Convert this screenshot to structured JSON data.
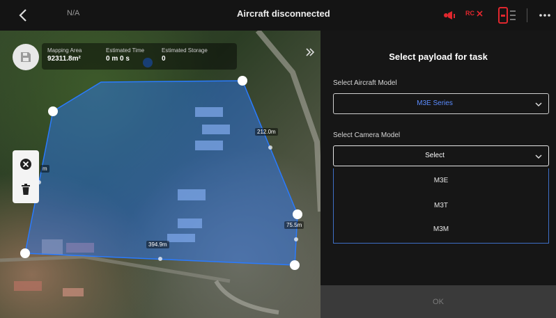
{
  "topbar": {
    "back_icon": "chevron-left-icon",
    "aircraft_label": "N/A",
    "status": "Aircraft disconnected",
    "rtk_icon": "rtk-signal-icon",
    "rc_label": "RC",
    "rc_status_icon": "close-icon",
    "battery_icon": "battery-icon",
    "more_icon": "more-icon",
    "alert_color": "#e0272e"
  },
  "map": {
    "save_icon": "save-icon",
    "info": [
      {
        "label": "Mapping Area",
        "value": "92311.8m²"
      },
      {
        "label": "Estimated Time",
        "value": "0 m 0 s"
      },
      {
        "label": "Estimated Storage",
        "value": "0"
      }
    ],
    "expand_icon": "double-chevron-right-icon",
    "tools": {
      "clear_icon": "close-circle-icon",
      "delete_icon": "trash-icon"
    },
    "distances": [
      "212.0m",
      "75.5m",
      "394.9m",
      "m"
    ],
    "polygon_fill": "#2a7bff"
  },
  "panel": {
    "title": "Select payload for task",
    "aircraft_label": "Select Aircraft Model",
    "aircraft_value": "M3E Series",
    "aircraft_value_color": "#5b8cff",
    "camera_label": "Select Camera Model",
    "camera_value": "Select",
    "options": [
      "M3E",
      "M3T",
      "M3M"
    ],
    "ok_label": "OK"
  }
}
